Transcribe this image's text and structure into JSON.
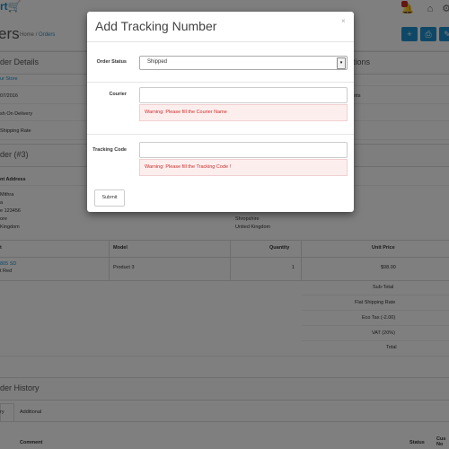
{
  "app": {
    "logo": "rt"
  },
  "header": {
    "title": "ers",
    "breadcrumb_home": "Home",
    "breadcrumb_sep": "/",
    "breadcrumb_current": "Orders"
  },
  "order_details": {
    "title": "der Details",
    "store": "ur Store",
    "date": "07/2016",
    "payment": "sh On Delivery",
    "shipping": "Shipping Rate"
  },
  "options": {
    "title": "tions",
    "points": "ints"
  },
  "order_block": {
    "title": "der (#3)"
  },
  "address": {
    "heading": "nt Address",
    "lines": [
      "Mithra",
      "a",
      "e 123456",
      "ore",
      "Kingdom"
    ],
    "right_lines": [
      "Shropshire",
      "United Kingdom"
    ]
  },
  "products": {
    "columns": {
      "product": "t",
      "model": "Model",
      "quantity": "Quantity",
      "unit_price": "Unit Price"
    },
    "row": {
      "product_link": "805 SD",
      "product_sub": "t Red",
      "model": "Product 3",
      "quantity": "1",
      "unit_price": "$98.00"
    },
    "totals": [
      "Sub-Total",
      "Flat Shipping Rate",
      "Eco Tax (-2.00)",
      "VAT (20%)",
      "Total"
    ]
  },
  "history": {
    "title": "der History",
    "tab_history": "ry",
    "tab_additional": "Additional",
    "col_comment": "Comment",
    "col_status": "Status",
    "col_notify": "Cus No"
  },
  "modal": {
    "title": "Add Tracking Number",
    "close": "×",
    "order_status_label": "Order Status",
    "order_status_value": "Shipped",
    "courier_label": "Courier",
    "courier_warning": "Warning: Please fill the Courier Name",
    "tracking_label": "Tracking Code",
    "tracking_warning": "Warning: Please fill the Tracking Code !",
    "submit": "Submit"
  },
  "colors": {
    "accent": "#1e91cf",
    "warning_text": "#c9302c",
    "warning_bg": "#fdeeee"
  },
  "icons": {
    "cart": "cart-icon",
    "bell": "bell-icon",
    "home": "home-icon",
    "gear": "gear-icon"
  }
}
